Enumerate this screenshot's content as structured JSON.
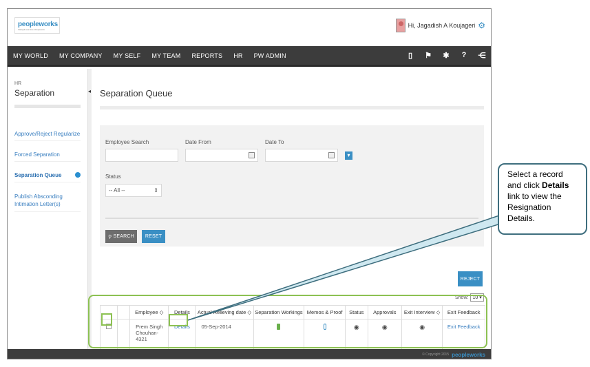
{
  "header": {
    "logo_text": "peopleworks",
    "logo_tagline": "Making life seamless at Peopleworks",
    "greeting": "Hi, Jagadish A Koujageri"
  },
  "nav": {
    "items": [
      "MY WORLD",
      "MY COMPANY",
      "MY SELF",
      "MY TEAM",
      "REPORTS",
      "HR",
      "PW ADMIN"
    ],
    "icons": [
      "book-icon",
      "flag-icon",
      "tools-icon",
      "help-icon",
      "share-icon"
    ]
  },
  "sidebar": {
    "section": "HR",
    "title": "Separation",
    "items": [
      {
        "label": "Approve/Reject Regularize"
      },
      {
        "label": "Forced Separation"
      },
      {
        "label": "Separation Queue"
      },
      {
        "label": "Publish Absconding Intimation Letter(s)"
      }
    ]
  },
  "main": {
    "title": "Separation Queue",
    "filters": {
      "employee_search_label": "Employee Search",
      "date_from_label": "Date From",
      "date_to_label": "Date To",
      "status_label": "Status",
      "status_value": "-- All --",
      "search_button": "SEARCH",
      "reset_button": "RESET"
    },
    "reject_button": "REJECT",
    "show_label": "Show:",
    "show_value": "10",
    "table": {
      "headers": [
        "",
        "Employee",
        "Details",
        "Actual Relieving date",
        "Separation Workings",
        "Memos & Proof",
        "Status",
        "Approvals",
        "Exit Interview",
        "Exit Feedback"
      ],
      "rows": [
        {
          "employee": "Prem Singh Chouhan-4321",
          "details": "Details",
          "relieving_date": "05-Sep-2014",
          "exit_feedback": "Exit Feedback"
        }
      ]
    }
  },
  "footer": {
    "copyright": "© Copyright 2015",
    "brand": "peopleworks"
  },
  "callout": {
    "text_1": "Select a record and click",
    "text_bold": "Details",
    "text_2": "link to view the Resignation Details."
  },
  "colors": {
    "accent": "#3a8fc4",
    "nav_bg": "#3c3c3c",
    "highlight": "#8cc152"
  }
}
